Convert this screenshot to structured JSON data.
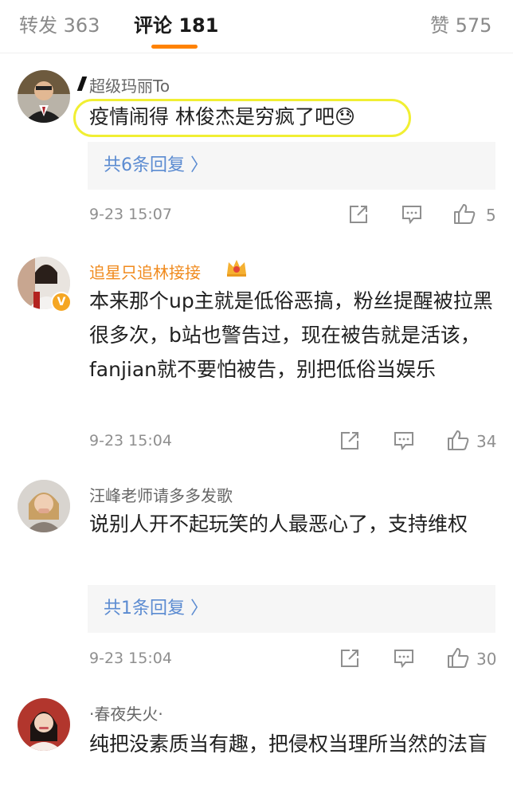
{
  "tabs": [
    {
      "label": "转发 363"
    },
    {
      "label": "评论 181"
    },
    {
      "label": "赞 575"
    }
  ],
  "colors": {
    "accent": "#ff8200",
    "link": "#5b8bd1",
    "vip_name": "#f08a1d",
    "highlight": "#f1ef33"
  },
  "comments": [
    {
      "name": "超级玛丽To",
      "text": "疫情闹得  林俊杰是穷疯了吧😓",
      "replies": "共6条回复 〉",
      "time": "9-23 15:07",
      "likes": "5"
    },
    {
      "name": "追星只追林接接",
      "text": "本来那个up主就是低俗恶搞，粉丝提醒被拉黑很多次，b站也警告过，现在被告就是活该，fanjian就不要怕被告，别把低俗当娱乐",
      "time": "9-23 15:04",
      "likes": "34"
    },
    {
      "name": "汪峰老师请多多发歌",
      "text": "说别人开不起玩笑的人最恶心了，支持维权",
      "replies": "共1条回复 〉",
      "time": "9-23 15:04",
      "likes": "30"
    },
    {
      "name": "·春夜失火·",
      "text": "纯把没素质当有趣，把侵权当理所当然的法盲"
    }
  ],
  "icons": {
    "share": "share-icon",
    "comment": "comment-icon",
    "like": "thumbs-up-icon",
    "verified": "verified-badge-icon",
    "crown": "crown-icon"
  }
}
